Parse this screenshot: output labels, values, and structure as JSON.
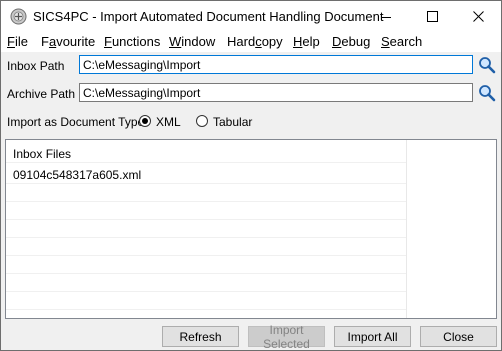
{
  "window": {
    "title": "SICS4PC - Import Automated Document Handling Document"
  },
  "menu": {
    "items": [
      {
        "accel": "F",
        "rest": "ile"
      },
      {
        "accel": "",
        "pre": "F",
        "mid": "a",
        "rest": "vourite"
      },
      {
        "accel": "F",
        "rest": "unctions"
      },
      {
        "accel": "W",
        "rest": "indow"
      },
      {
        "accel": "",
        "pre": "Hard",
        "mid": "c",
        "rest": "opy"
      },
      {
        "accel": "H",
        "rest": "elp"
      },
      {
        "accel": "D",
        "rest": "ebug"
      },
      {
        "accel": "S",
        "rest": "earch"
      }
    ]
  },
  "form": {
    "inbox_label": "Inbox Path",
    "inbox_value": "C:\\eMessaging\\Import",
    "archive_label": "Archive Path",
    "archive_value": "C:\\eMessaging\\Import",
    "doc_type_label": "Import as Document Type",
    "doc_types": [
      {
        "label": "XML",
        "selected": true
      },
      {
        "label": "Tabular",
        "selected": false
      }
    ]
  },
  "list": {
    "header": "Inbox Files",
    "items": [
      "09104c548317a605.xml"
    ]
  },
  "buttons": {
    "refresh": "Refresh",
    "import_selected": "Import Selected",
    "import_all": "Import All",
    "close": "Close"
  }
}
